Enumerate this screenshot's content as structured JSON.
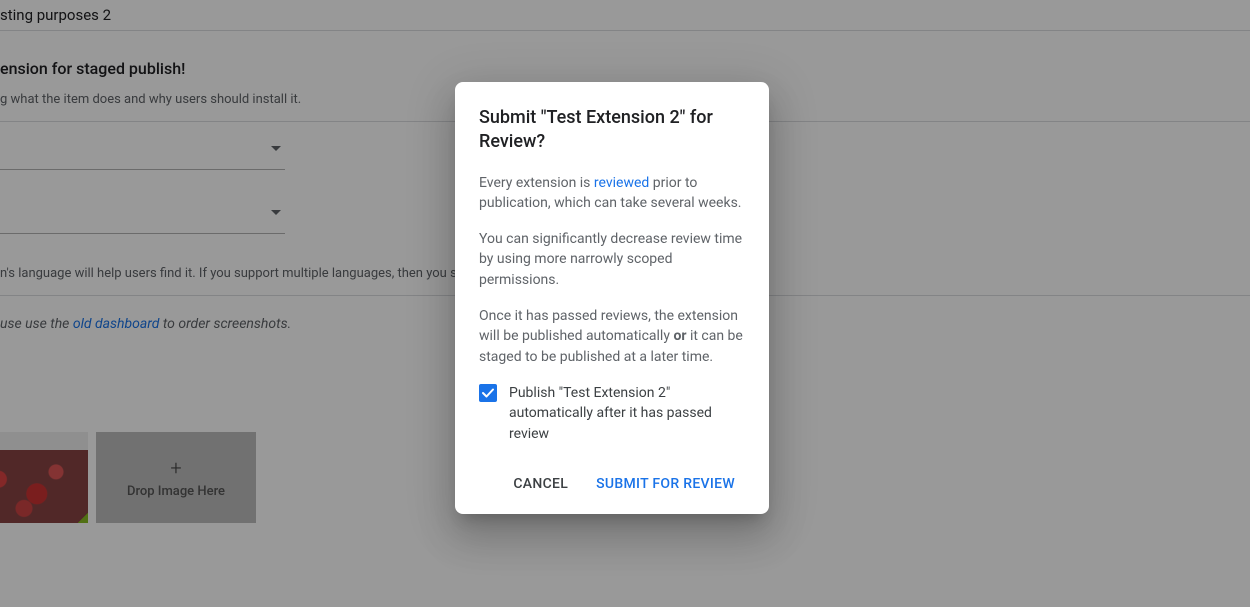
{
  "background": {
    "title_partial": "sting purposes 2",
    "heading_partial": "ension for staged publish!",
    "helper_partial": "g what the item does and why users should install it.",
    "lang_helper_partial": "n's language will help users find it. If you support multiple languages, then you sl",
    "note_prefix": "use use the ",
    "note_link": "old dashboard",
    "note_suffix": " to order screenshots.",
    "drop_label": "Drop Image Here"
  },
  "dialog": {
    "title": "Submit \"Test Extension 2\" for Review?",
    "p1_pre": "Every extension is ",
    "p1_link": "reviewed",
    "p1_post": " prior to publication, which can take several weeks.",
    "p2": "You can significantly decrease review time by using more narrowly scoped permissions.",
    "p3_pre": "Once it has passed reviews, the extension will be published automatically ",
    "p3_bold": "or",
    "p3_post": " it can be staged to be published at a later time.",
    "checkbox_label": "Publish \"Test Extension 2\" automatically after it has passed review",
    "cancel": "CANCEL",
    "submit": "SUBMIT FOR REVIEW"
  }
}
